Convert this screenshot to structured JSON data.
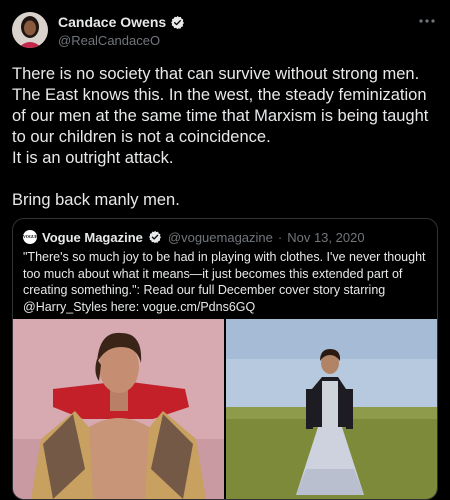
{
  "author": {
    "display_name": "Candace Owens",
    "handle": "@RealCandaceO"
  },
  "tweet": {
    "text": "There is no society that can survive without strong men. The East knows this. In the west, the steady feminization of our men at the same time that Marxism is being taught to our children is not a coincidence.\nIt is an outright attack.\n\nBring back manly men."
  },
  "quoted": {
    "avatar_text": "VOGUE",
    "name": "Vogue Magazine",
    "handle": "@voguemagazine",
    "separator": "·",
    "date": "Nov 13, 2020",
    "text": "\"There's so much joy to be had in playing with clothes. I've never thought too much about what it means—it just becomes this extended part of creating something.\": Read our full December cover story starring @Harry_Styles here: vogue.cm/Pdns6GQ"
  },
  "colors": {
    "background": "#000000",
    "text": "#e7e9ea",
    "muted": "#71767b",
    "verified": "#1d9bf0",
    "border": "#2f3336"
  },
  "icons": [
    "verified-badge-icon",
    "more-icon"
  ]
}
